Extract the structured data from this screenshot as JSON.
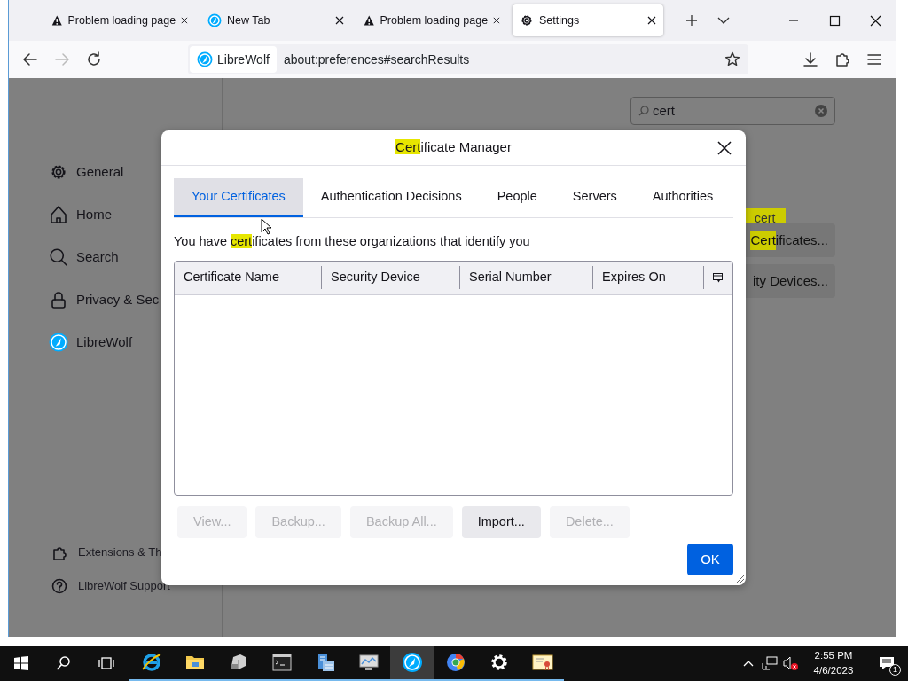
{
  "browser": {
    "tabs": [
      {
        "title": "Problem loading page",
        "kind": "warning",
        "selected": false
      },
      {
        "title": "New Tab",
        "kind": "wolf",
        "selected": false
      },
      {
        "title": "Problem loading page",
        "kind": "warning",
        "selected": false
      },
      {
        "title": "Settings",
        "kind": "gear",
        "selected": true
      }
    ],
    "address": {
      "identity": "LibreWolf",
      "url": "about:preferences#searchResults"
    }
  },
  "settings": {
    "search": {
      "value": "cert"
    },
    "sidebar": [
      {
        "label": "General",
        "kind": "gear"
      },
      {
        "label": "Home",
        "kind": "home"
      },
      {
        "label": "Search",
        "kind": "search"
      },
      {
        "label": "Privacy & Sec",
        "kind": "lock"
      },
      {
        "label": "LibreWolf",
        "kind": "wolf"
      }
    ],
    "footer": [
      {
        "label": "Extensions & Th",
        "kind": "puzzle"
      },
      {
        "label": "LibreWolf Support",
        "kind": "help"
      }
    ],
    "search_tooltip": "cert",
    "buttons": [
      {
        "parts": [
          {
            "text": "Cert",
            "highlighted": true
          },
          {
            "text": "ificates...",
            "highlighted": false
          }
        ]
      },
      {
        "parts": [
          {
            "text": "ity Devices...",
            "highlighted": false
          }
        ]
      }
    ]
  },
  "dialog": {
    "title": [
      {
        "text": "Cert",
        "highlighted": true
      },
      {
        "text": "ificate Manager",
        "highlighted": false
      }
    ],
    "tabs": [
      {
        "label": "Your Certificates",
        "selected": true
      },
      {
        "label": "Authentication Decisions",
        "selected": false
      },
      {
        "label": "People",
        "selected": false
      },
      {
        "label": "Servers",
        "selected": false
      },
      {
        "label": "Authorities",
        "selected": false
      }
    ],
    "intro": [
      {
        "text": "You have ",
        "highlighted": false
      },
      {
        "text": "cert",
        "highlighted": true
      },
      {
        "text": "ificates from these organizations that identify you",
        "highlighted": false
      }
    ],
    "columns": [
      "Certificate Name",
      "Security Device",
      "Serial Number",
      "Expires On"
    ],
    "buttons": [
      {
        "label": "View...",
        "disabled": true
      },
      {
        "label": "Backup...",
        "disabled": true
      },
      {
        "label": "Backup All...",
        "disabled": true
      },
      {
        "label": "Import...",
        "disabled": false
      },
      {
        "label": "Delete...",
        "disabled": true
      }
    ],
    "ok": "OK"
  },
  "taskbar": {
    "apps": [
      {
        "kind": "ie",
        "active": false
      },
      {
        "kind": "folder",
        "active": false
      },
      {
        "kind": "package",
        "active": false
      },
      {
        "kind": "terminal",
        "active": false
      },
      {
        "kind": "server",
        "active": false
      },
      {
        "kind": "monitor",
        "active": false
      },
      {
        "kind": "wolf",
        "active": true
      },
      {
        "kind": "globe",
        "active": false
      },
      {
        "kind": "gear",
        "active": false
      },
      {
        "kind": "certificate",
        "active": false
      }
    ],
    "time": "2:55 PM",
    "date": "4/6/2023",
    "notifications": "1"
  }
}
